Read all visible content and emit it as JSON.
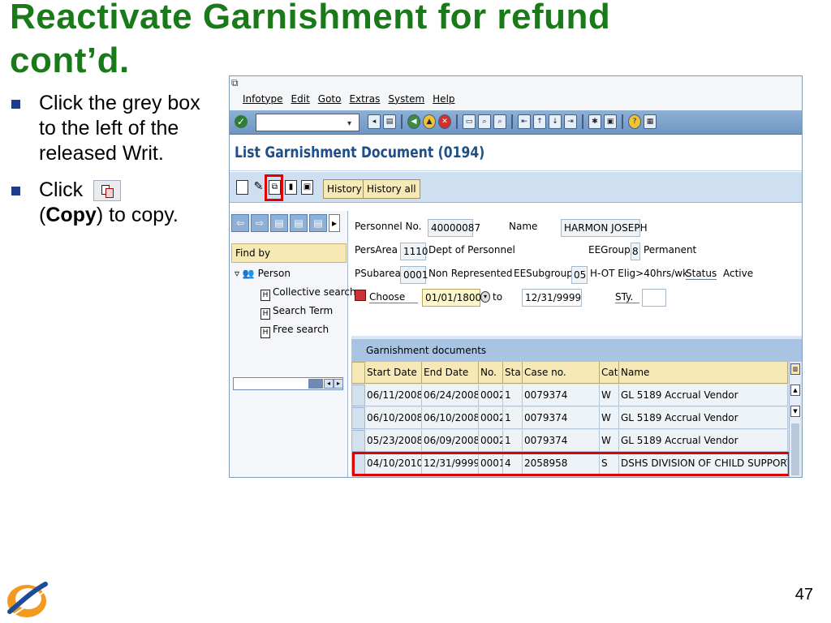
{
  "slide": {
    "title_line1": "Reactivate Garnishment for refund",
    "title_line2": "cont’d.",
    "bullet1": "Click the grey box to the left of the released Writ.",
    "bullet2_pre": "Click",
    "bullet2_paren_open": "(",
    "bullet2_bold": "Copy",
    "bullet2_post": ") to copy.",
    "page_number": "47"
  },
  "sap": {
    "menu": [
      "Infotype",
      "Edit",
      "Goto",
      "Extras",
      "System",
      "Help"
    ],
    "command_field_value": "",
    "screen_title": "List Garnishment Document (0194)",
    "app_buttons": [
      "History",
      "History all"
    ],
    "nav": {
      "find_by": "Find by",
      "person": "Person",
      "collective_search": "Collective search",
      "search_term": "Search Term",
      "free_search": "Free search"
    },
    "header": {
      "personnel_no_label": "Personnel No.",
      "personnel_no": "40000087",
      "name_label": "Name",
      "name": "HARMON JOSEPH",
      "persarea_label": "PersArea",
      "persarea_code": "1110",
      "persarea_text": "Dept of Personnel",
      "eegroup_label": "EEGroup",
      "eegroup_code": "8",
      "eegroup_text": "Permanent",
      "psubarea_label": "PSubarea",
      "psubarea_code": "0001",
      "psubarea_text": "Non Represented",
      "eesubgroup_label": "EESubgroup",
      "eesubgroup_code": "05",
      "eesubgroup_text": "H-OT Elig>40hrs/wk",
      "status_label": "Status",
      "status_text": "Active",
      "choose_label": "Choose",
      "from_date": "01/01/1800",
      "to_label": "to",
      "to_date": "12/31/9999",
      "sty_label": "STy.",
      "sty_value": ""
    },
    "table": {
      "title": "Garnishment documents",
      "columns": [
        "Start Date",
        "End Date",
        "No.",
        "Sta",
        "Case no.",
        "Cat",
        "Name"
      ],
      "rows": [
        [
          "06/11/2008",
          "06/24/2008",
          "0002",
          "1",
          "0079374",
          "W",
          "GL 5189 Accrual Vendor"
        ],
        [
          "06/10/2008",
          "06/10/2008",
          "0002",
          "1",
          "0079374",
          "W",
          "GL 5189 Accrual Vendor"
        ],
        [
          "05/23/2008",
          "06/09/2008",
          "0002",
          "1",
          "0079374",
          "W",
          "GL 5189 Accrual Vendor"
        ],
        [
          "04/10/2010",
          "12/31/9999",
          "0001",
          "4",
          "2058958",
          "S",
          "DSHS DIVISION OF CHILD SUPPORT"
        ]
      ]
    }
  },
  "colors": {
    "title_green": "#1a7a1a",
    "highlight_red": "#e00000",
    "sap_toolbar_blue": "#6f96c3"
  }
}
